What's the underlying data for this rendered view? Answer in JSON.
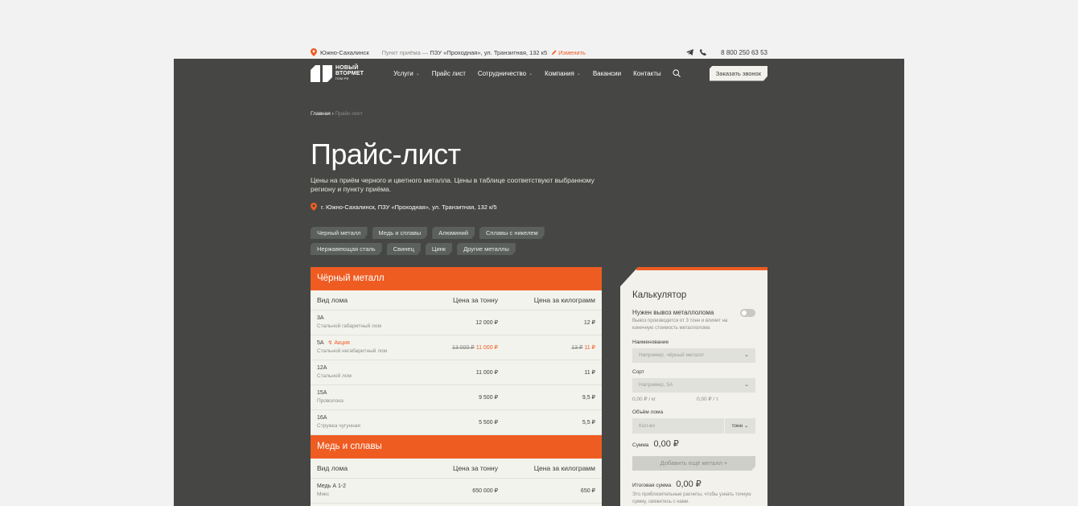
{
  "topbar": {
    "city": "Южно-Сахалинск",
    "point_label": "Пункт приёма —",
    "point_value": "ПЗУ «Проходная», ул. Транзитная, 132 к5",
    "change": "Изменить",
    "phone": "8 800 250 63 53"
  },
  "logo": {
    "line1": "НОВЫЙ",
    "line2": "ВТОРМЕТ",
    "line3": "ПЗМ РФ"
  },
  "nav": {
    "items": [
      "Услуги",
      "Прайс лист",
      "Сотрудничество",
      "Компания",
      "Вакансии",
      "Контакты"
    ],
    "callback": "Заказать звонок"
  },
  "breadcrumb": {
    "home": "Главная",
    "sep": "›",
    "current": "Прайс-лист"
  },
  "page": {
    "title": "Прайс-лист",
    "description": "Цены на приём черного и цветного металла. Цены в таблице соответствуют выбранному региону и пункту приёма.",
    "address": "г. Южно-Сахалинск, ПЗУ «Проходная», ул. Транзитная, 132 к/5"
  },
  "chips": [
    "Черный металл",
    "Медь и сплавы",
    "Алюминий",
    "Сплавы с никелем",
    "Нержавеющая сталь",
    "Свинец",
    "Цинк",
    "Другие металлы"
  ],
  "table": {
    "col_type": "Вид лома",
    "col_ton": "Цена за тонну",
    "col_kg": "Цена за килограмм",
    "sections": [
      {
        "title": "Чёрный металл",
        "rows": [
          {
            "code": "3А",
            "name": "Стальной габаритный лом",
            "ton": "12 000 ₽",
            "kg": "12 ₽"
          },
          {
            "code": "5А",
            "promo": "Акция",
            "name": "Стальной негабаритный лом",
            "ton_old": "13 000 ₽",
            "ton": "11 000 ₽",
            "kg_old": "13 ₽",
            "kg": "11 ₽"
          },
          {
            "code": "12А",
            "name": "Стальной лом",
            "ton": "11 000 ₽",
            "kg": "11 ₽"
          },
          {
            "code": "15А",
            "name": "Проволока",
            "ton": "9 500 ₽",
            "kg": "9,5 ₽"
          },
          {
            "code": "16А",
            "name": "Стружка чугунная",
            "ton": "5 500 ₽",
            "kg": "5,5 ₽"
          }
        ]
      },
      {
        "title": "Медь и сплавы",
        "rows": [
          {
            "code": "Медь А 1-2",
            "name": "Микс",
            "ton": "650 000 ₽",
            "kg": "650 ₽"
          }
        ]
      }
    ]
  },
  "calculator": {
    "title": "Калькулятор",
    "removal_label": "Нужен вывоз металлолома",
    "removal_note": "Вывоз производится от 3 тонн и влияет на конечную стоимость металлолома",
    "name_label": "Наименование",
    "name_placeholder": "Например, чёрный металл",
    "grade_label": "Сорт",
    "grade_placeholder": "Например, 5А",
    "price_kg": "0,00 ₽ / кг",
    "price_t": "0,00 ₽ / т",
    "volume_label": "Объём лома",
    "volume_placeholder": "Кол-во",
    "unit": "тонн",
    "sum_label": "Сумма",
    "sum_value": "0,00 ₽",
    "add_button": "Добавить ещё металл  +",
    "total_label": "Итоговая сумма",
    "total_value": "0,00 ₽",
    "total_note": "Это приблизительные расчеты, чтобы узнать точную сумму, свяжитесь с нами."
  },
  "colors": {
    "accent": "#ef5c22",
    "dark": "#464744",
    "light": "#f3f3ee"
  }
}
